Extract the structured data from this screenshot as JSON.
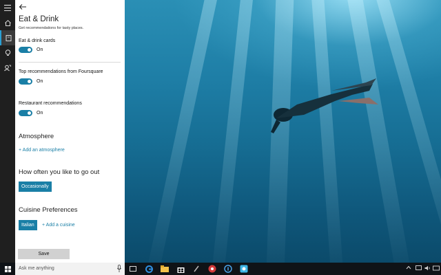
{
  "panel": {
    "title": "Eat & Drink",
    "subtitle": "Get recommendations for tasty places.",
    "settings": [
      {
        "label": "Eat & drink cards",
        "state": "On"
      },
      {
        "label": "Top recommendations from Foursquare",
        "state": "On"
      },
      {
        "label": "Restaurant recommendations",
        "state": "On"
      }
    ],
    "atmosphere": {
      "heading": "Atmosphere",
      "add_link": "+ Add an atmosphere"
    },
    "going_out": {
      "heading": "How often you like to go out",
      "selected": "Occasionally"
    },
    "cuisine": {
      "heading": "Cuisine Preferences",
      "selected": "Italian",
      "add_link": "+ Add a cuisine"
    },
    "save_label": "Save"
  },
  "taskbar": {
    "search_placeholder": "Ask me anything"
  },
  "colors": {
    "accent": "#1a7fa6",
    "rail": "#1f1f1f",
    "taskbar": "#0f1317"
  },
  "icons": {
    "rail": [
      "hamburger-icon",
      "home-icon",
      "notebook-icon",
      "lightbulb-icon",
      "feedback-icon"
    ],
    "taskbar": [
      "windows-start-icon",
      "microphone-icon",
      "task-view-icon",
      "edge-icon",
      "file-explorer-icon",
      "store-icon",
      "app-icon",
      "app-icon",
      "app-icon",
      "app-icon",
      "chevron-up-icon",
      "network-icon",
      "volume-icon",
      "keyboard-icon"
    ]
  }
}
